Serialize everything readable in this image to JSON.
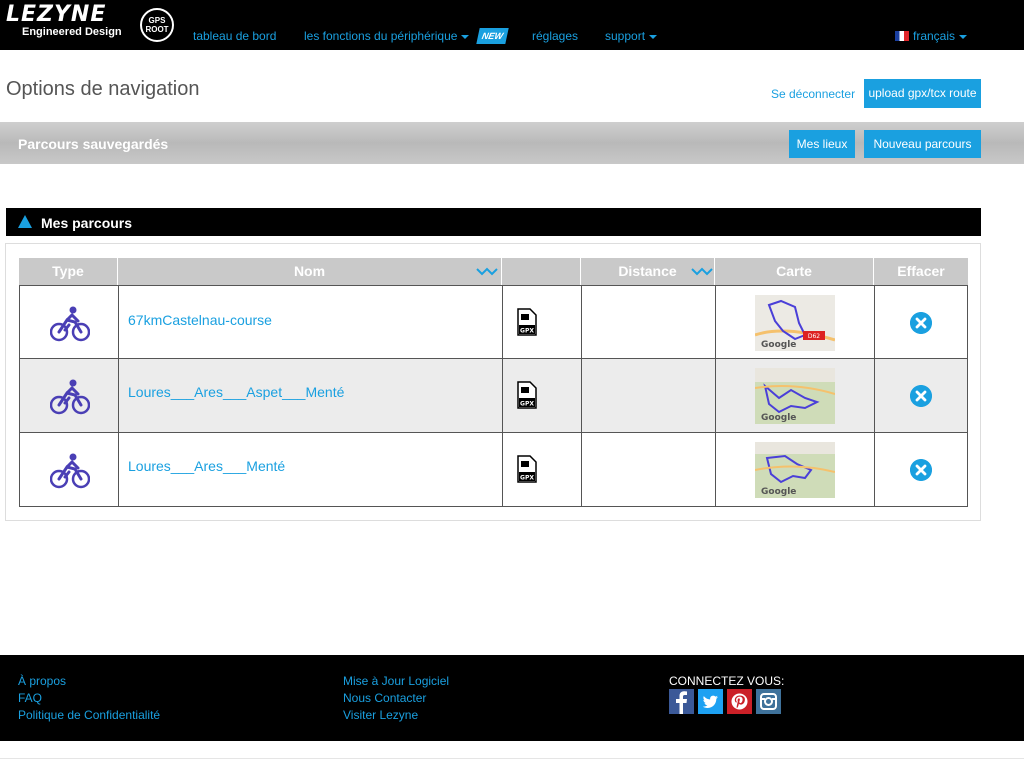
{
  "brand": {
    "name": "LEZYNE",
    "tagline": "Engineered Design",
    "badge": "GPS ROOT"
  },
  "nav": {
    "dashboard": "tableau de bord",
    "features": "les fonctions du périphérique",
    "new_badge": "NEW",
    "settings": "réglages",
    "support": "support",
    "language": "français"
  },
  "page": {
    "title": "Options de navigation",
    "logout": "Se déconnecter",
    "upload_button": "upload gpx/tcx route"
  },
  "saved_bar": {
    "title": "Parcours sauvegardés",
    "my_places": "Mes lieux",
    "new_route": "Nouveau parcours"
  },
  "section": {
    "title": "Mes parcours"
  },
  "table": {
    "headers": {
      "type": "Type",
      "name": "Nom",
      "distance": "Distance",
      "map": "Carte",
      "delete": "Effacer"
    },
    "rows": [
      {
        "name": "67kmCastelnau-course",
        "distance": "",
        "map_badge": "D62"
      },
      {
        "name": "Loures___Ares___Aspet___Menté",
        "distance": ""
      },
      {
        "name": "Loures___Ares___Menté",
        "distance": ""
      }
    ],
    "file_label": "GPX",
    "map_brand": "Google"
  },
  "footer": {
    "about": "À propos",
    "faq": "FAQ",
    "privacy": "Politique de Confidentialité",
    "update": "Mise à Jour Logiciel",
    "contact": "Nous Contacter",
    "visit": "Visiter Lezyne",
    "connect": "CONNECTEZ VOUS:"
  },
  "colors": {
    "accent": "#1aa0e0",
    "bike_icon": "#4a3fb5",
    "facebook": "#3b5998",
    "twitter": "#1da1f2",
    "pinterest": "#cb2027",
    "instagram": "#3f729b"
  },
  "icons": [
    "bike-icon",
    "gpx-file-icon",
    "delete-icon",
    "sort-icon",
    "facebook-icon",
    "twitter-icon",
    "pinterest-icon",
    "instagram-icon"
  ]
}
